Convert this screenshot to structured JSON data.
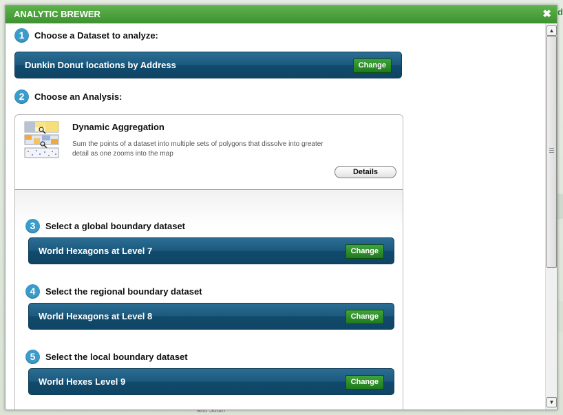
{
  "dialog": {
    "title": "ANALYTIC BREWER",
    "close_glyph": "✖"
  },
  "map": {
    "edge_text": "d",
    "label_text": "and South"
  },
  "steps": [
    {
      "number": "1",
      "label": "Choose a Dataset to analyze:"
    },
    {
      "number": "2",
      "label": "Choose an Analysis:"
    },
    {
      "number": "3",
      "label": "Select a global boundary dataset"
    },
    {
      "number": "4",
      "label": "Select the regional boundary dataset"
    },
    {
      "number": "5",
      "label": "Select the local boundary dataset"
    }
  ],
  "datasets": {
    "main": {
      "name": "Dunkin Donut locations by Address",
      "button": "Change"
    },
    "global": {
      "name": "World Hexagons at Level 7",
      "button": "Change"
    },
    "regional": {
      "name": "World Hexagons at Level 8",
      "button": "Change"
    },
    "local": {
      "name": "World Hexes Level 9",
      "button": "Change"
    }
  },
  "analysis": {
    "title": "Dynamic Aggregation",
    "description": "Sum the points of a dataset into multiple sets of polygons that dissolve into greater detail as one zooms into the map",
    "details_button": "Details",
    "icon": "aggregation-thumbnail-icon"
  },
  "scrollbar": {
    "up_glyph": "▲",
    "down_glyph": "▼"
  },
  "colors": {
    "title_bar": "#4aa33c",
    "step_badge": "#3b9bc9",
    "dataset_bar": "#1c5a7f",
    "change_button": "#2d8f2b"
  }
}
